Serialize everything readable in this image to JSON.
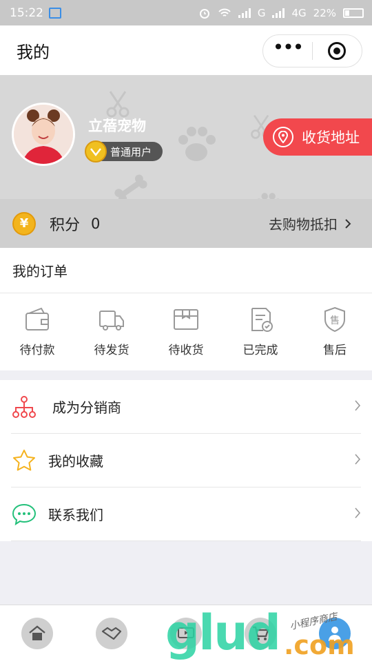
{
  "status_bar": {
    "time": "15:22",
    "network1": "G",
    "network2": "4G",
    "battery": "22%"
  },
  "nav": {
    "title": "我的",
    "more_glyph": "•••"
  },
  "profile": {
    "username": "立蓓宠物",
    "level": "普通用户",
    "address_button": "收货地址"
  },
  "points": {
    "label": "积分",
    "value": "0",
    "action": "去购物抵扣"
  },
  "orders": {
    "title": "我的订单",
    "items": [
      {
        "label": "待付款",
        "icon": "wallet-icon"
      },
      {
        "label": "待发货",
        "icon": "truck-icon"
      },
      {
        "label": "待收货",
        "icon": "box-icon"
      },
      {
        "label": "已完成",
        "icon": "done-icon"
      },
      {
        "label": "售后",
        "icon": "after-sale-icon"
      }
    ]
  },
  "menu": [
    {
      "label": "成为分销商",
      "icon": "distributor-icon",
      "color": "#f0484d"
    },
    {
      "label": "我的收藏",
      "icon": "star-icon",
      "color": "#f5b21e"
    },
    {
      "label": "联系我们",
      "icon": "chat-icon",
      "color": "#23c07a"
    }
  ],
  "tabbar": {
    "tabs": [
      "home-icon",
      "handshake-icon",
      "video-icon",
      "cart-icon",
      "user-icon"
    ]
  },
  "watermark": {
    "main": "glud",
    "suffix": ".com",
    "tag": "小程序商店"
  },
  "colors": {
    "accent_red": "#f2484d",
    "coin": "#f3b41d",
    "tab_active": "#4aa0e6"
  }
}
